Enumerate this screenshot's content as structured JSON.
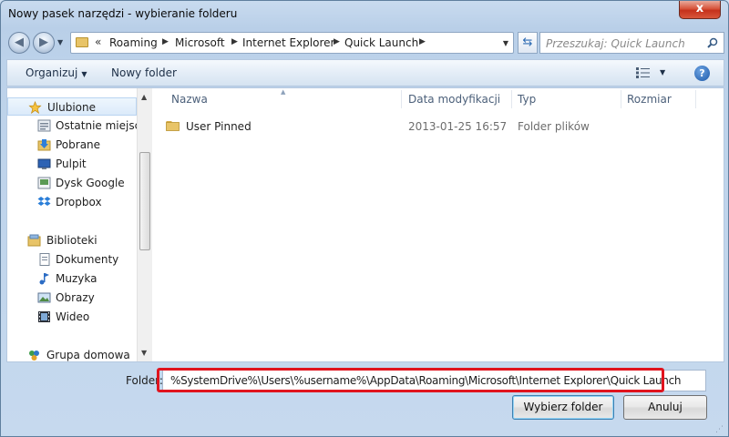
{
  "window": {
    "title": "Nowy pasek narzędzi - wybieranie folderu",
    "close_glyph": "x"
  },
  "navigation": {
    "back_icon": "back-arrow-icon",
    "forward_icon": "forward-arrow-icon",
    "address": {
      "overflow": "«",
      "crumbs": [
        "Roaming",
        "Microsoft",
        "Internet Explorer",
        "Quick Launch"
      ],
      "separator": "▶"
    },
    "search_placeholder": "Przeszukaj: Quick Launch"
  },
  "commandbar": {
    "organize_label": "Organizuj",
    "new_folder_label": "Nowy folder",
    "help_glyph": "?"
  },
  "navpane": {
    "favorites": {
      "label": "Ulubione",
      "items": [
        {
          "label": "Ostatnie miejsca",
          "icon": "recent-places-icon"
        },
        {
          "label": "Pobrane",
          "icon": "downloads-icon"
        },
        {
          "label": "Pulpit",
          "icon": "desktop-icon"
        },
        {
          "label": "Dysk Google",
          "icon": "google-drive-icon"
        },
        {
          "label": "Dropbox",
          "icon": "dropbox-icon"
        }
      ]
    },
    "libraries": {
      "label": "Biblioteki",
      "items": [
        {
          "label": "Dokumenty",
          "icon": "documents-icon"
        },
        {
          "label": "Muzyka",
          "icon": "music-icon"
        },
        {
          "label": "Obrazy",
          "icon": "pictures-icon"
        },
        {
          "label": "Wideo",
          "icon": "video-icon"
        }
      ]
    },
    "homegroup": {
      "label": "Grupa domowa",
      "icon": "homegroup-icon"
    }
  },
  "filelist": {
    "columns": [
      "Nazwa",
      "Data modyfikacji",
      "Typ",
      "Rozmiar"
    ],
    "rows": [
      {
        "name": "User Pinned",
        "modified": "2013-01-25 16:57",
        "type": "Folder plików",
        "size": ""
      }
    ]
  },
  "footer": {
    "folder_label": "Folder:",
    "folder_value": "%SystemDrive%\\Users\\%username%\\AppData\\Roaming\\Microsoft\\Internet Explorer\\Quick Launch",
    "select_button": "Wybierz folder",
    "cancel_button": "Anuluj"
  },
  "colors": {
    "highlight_border": "#e0141e",
    "folder_yellow": "#e8c468",
    "accent_blue": "#1a57a8"
  }
}
